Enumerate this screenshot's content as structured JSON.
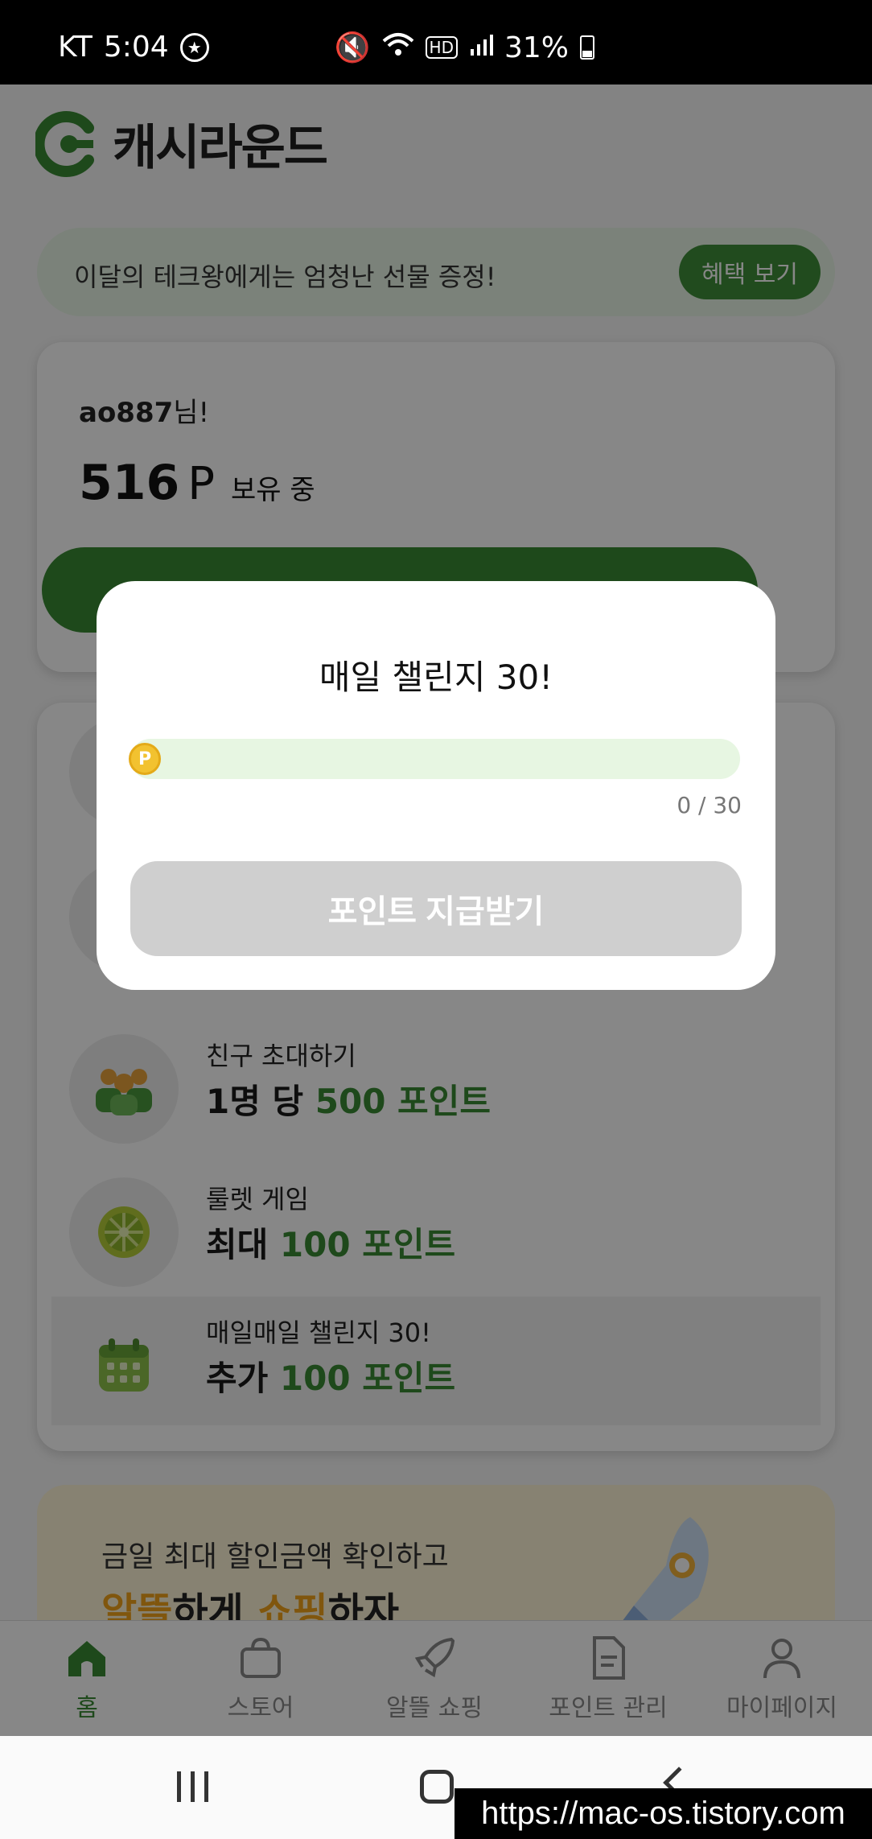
{
  "status_bar": {
    "carrier": "KT",
    "time": "5:04",
    "hd": "HD",
    "battery": "31%"
  },
  "app": {
    "logo_text": "캐시라운드"
  },
  "promo": {
    "text": "이달의 테크왕에게는 엄청난 선물 증정!",
    "button": "혜택 보기"
  },
  "user_card": {
    "username": "ao887",
    "suffix": "님!",
    "points": "516",
    "unit": "P",
    "holding": "보유 중"
  },
  "rewards": [
    {
      "label": "친구 초대하기",
      "prefix": "1명 당 ",
      "amount": "500 포인트"
    },
    {
      "label": "룰렛 게임",
      "prefix": "최대 ",
      "amount": "100 포인트"
    },
    {
      "label": "매일매일 챌린지 30!",
      "prefix": "추가 ",
      "amount": "100 포인트"
    }
  ],
  "banner": {
    "line1": "금일 최대 할인금액 확인하고",
    "line2_a": "알뜰",
    "line2_b": "하게 ",
    "line2_c": "쇼핑",
    "line2_d": "하자"
  },
  "bottom_nav": [
    {
      "label": "홈",
      "icon": "home-icon"
    },
    {
      "label": "스토어",
      "icon": "bag-icon"
    },
    {
      "label": "알뜰 쇼핑",
      "icon": "rocket-icon"
    },
    {
      "label": "포인트 관리",
      "icon": "document-icon"
    },
    {
      "label": "마이페이지",
      "icon": "person-icon"
    }
  ],
  "modal": {
    "title": "매일 챌린지 30!",
    "progress_current": 0,
    "progress_total": 30,
    "progress_text": "0 / 30",
    "coin_label": "P",
    "button": "포인트 지급받기"
  },
  "watermark": "https://mac-os.tistory.com",
  "colors": {
    "accent": "#3a8a34",
    "track": "#e7f6e2",
    "coin": "#f2c230",
    "disabled": "#cfcfcf"
  }
}
